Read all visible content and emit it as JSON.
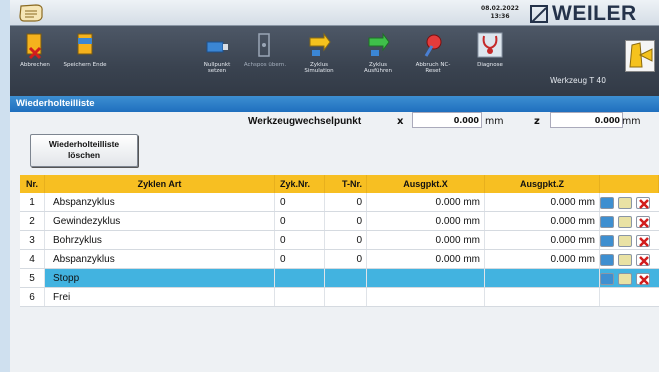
{
  "header": {
    "date": "08.02.2022",
    "time": "13:36",
    "logo_text": "WEILER",
    "werkzeug_label": "Werkzeug T 40"
  },
  "toolbar": {
    "items": [
      {
        "label": "Abbrechen",
        "icon": "abort-icon"
      },
      {
        "label": "Speichern Ende",
        "icon": "save-icon"
      },
      {
        "label": "Nullpunkt setzen",
        "icon": "zero-point-icon"
      },
      {
        "label": "Achspos übern.",
        "icon": "axis-position-icon"
      },
      {
        "label": "Zyklus Simulation",
        "icon": "cycle-simulation-icon"
      },
      {
        "label": "Zyklus Ausführen",
        "icon": "cycle-execute-icon"
      },
      {
        "label": "Abbruch NC-Reset",
        "icon": "nc-reset-icon"
      },
      {
        "label": "Diagnose",
        "icon": "diagnosis-icon"
      }
    ]
  },
  "window": {
    "title": "Wiederholteilliste"
  },
  "toolchange": {
    "label": "Werkzeugwechselpunkt",
    "x_label": "x",
    "x_value": "0.000",
    "x_unit": "mm",
    "z_label": "z",
    "z_value": "0.000",
    "z_unit": "mm"
  },
  "clear_button": {
    "line1": "Wiederholteilliste",
    "line2": "löschen"
  },
  "table": {
    "columns": [
      "Nr.",
      "Zyklen Art",
      "Zyk.Nr.",
      "T-Nr.",
      "Ausgpkt.X",
      "Ausgpkt.Z"
    ],
    "rows": [
      {
        "nr": "1",
        "art": "Abspanzyklus",
        "zyk": "0",
        "t": "0",
        "x": "0.000  mm",
        "z": "0.000  mm"
      },
      {
        "nr": "2",
        "art": "Gewindezyklus",
        "zyk": "0",
        "t": "0",
        "x": "0.000  mm",
        "z": "0.000  mm"
      },
      {
        "nr": "3",
        "art": "Bohrzyklus",
        "zyk": "0",
        "t": "0",
        "x": "0.000  mm",
        "z": "0.000  mm"
      },
      {
        "nr": "4",
        "art": "Abspanzyklus",
        "zyk": "0",
        "t": "0",
        "x": "0.000  mm",
        "z": "0.000  mm"
      },
      {
        "nr": "5",
        "art": "Stopp",
        "zyk": "",
        "t": "",
        "x": "",
        "z": ""
      },
      {
        "nr": "6",
        "art": "Frei",
        "zyk": "",
        "t": "",
        "x": "",
        "z": ""
      }
    ]
  },
  "colors": {
    "accent": "#1f6fbe",
    "header_row": "#f7bf22",
    "selected_row": "#42b3e0"
  }
}
